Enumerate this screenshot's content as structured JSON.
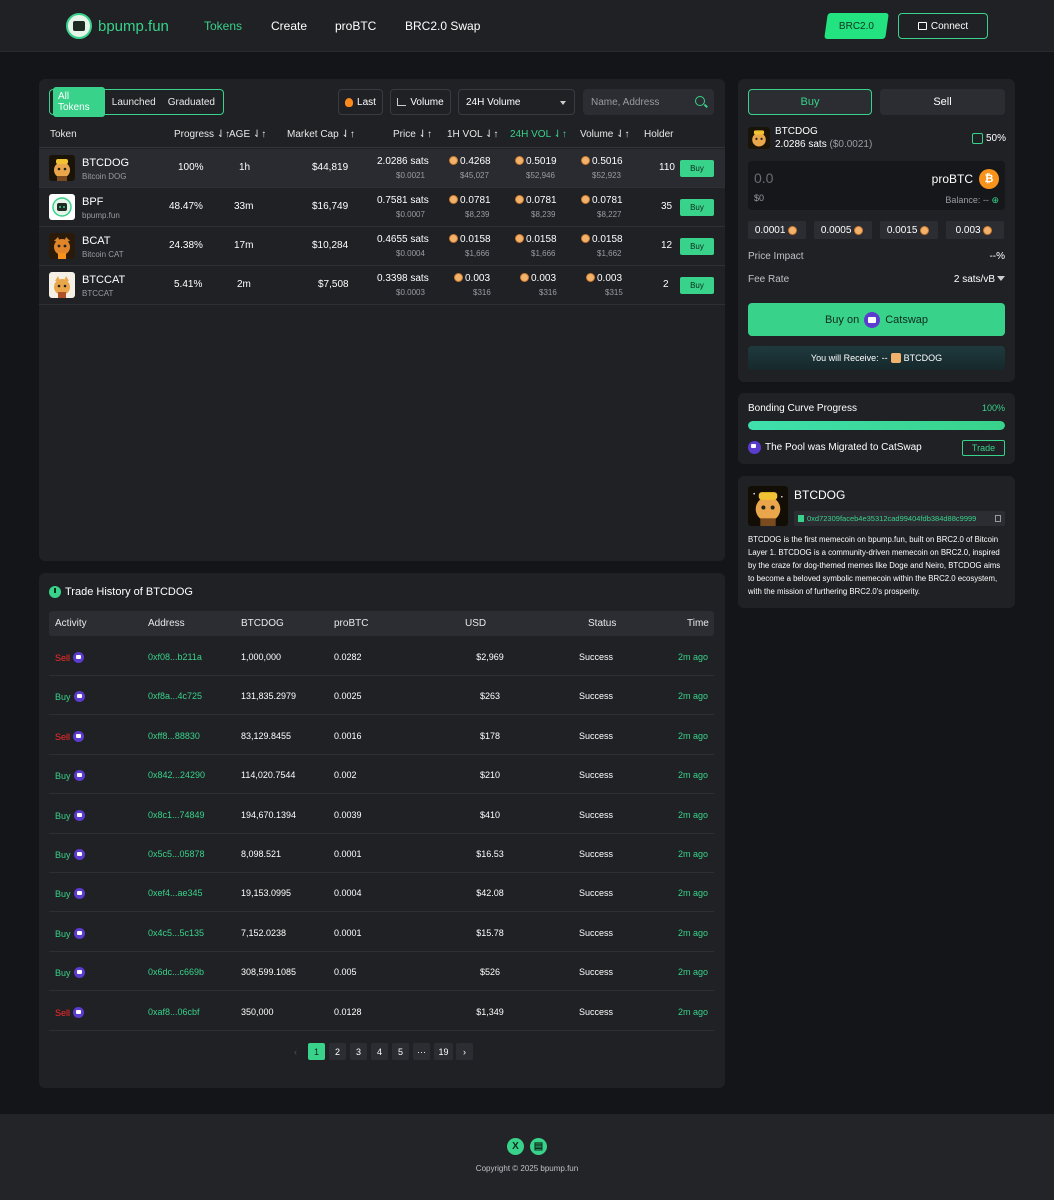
{
  "header": {
    "brand": "bpump.fun",
    "nav": [
      "Tokens",
      "Create",
      "proBTC",
      "BRC2.0 Swap"
    ],
    "network_badge": "BRC2.0",
    "connect_label": "Connect"
  },
  "tokens": {
    "filters": [
      "All Tokens",
      "Launched",
      "Graduated"
    ],
    "sort_last": "Last",
    "sort_volume": "Volume",
    "volume_select": "24H Volume",
    "search_placeholder": "Name, Address",
    "columns": [
      "Token",
      "Progress ⇃↑",
      "AGE ⇃↑",
      "Market Cap ⇃↑",
      "Price ⇃↑",
      "1H VOL ⇃↑",
      "24H VOL ⇃↑",
      "Volume ⇃↑",
      "Holder"
    ],
    "rows": [
      {
        "name": "BTCDOG",
        "sub": "Bitcoin DOG",
        "progress": "100%",
        "age": "1h",
        "mcap": "$44,819",
        "price": "2.0286 sats",
        "price_usd": "$0.0021",
        "vol1h": "0.4268",
        "vol1h_usd": "$45,027",
        "vol24h": "0.5019",
        "vol24h_usd": "$52,946",
        "vol": "0.5016",
        "vol_usd": "$52,923",
        "holders": "110",
        "buy": "Buy"
      },
      {
        "name": "BPF",
        "sub": "bpump.fun",
        "progress": "48.47%",
        "age": "33m",
        "mcap": "$16,749",
        "price": "0.7581 sats",
        "price_usd": "$0.0007",
        "vol1h": "0.0781",
        "vol1h_usd": "$8,239",
        "vol24h": "0.0781",
        "vol24h_usd": "$8,239",
        "vol": "0.0781",
        "vol_usd": "$8,227",
        "holders": "35",
        "buy": "Buy"
      },
      {
        "name": "BCAT",
        "sub": "Bitcoin CAT",
        "progress": "24.38%",
        "age": "17m",
        "mcap": "$10,284",
        "price": "0.4655 sats",
        "price_usd": "$0.0004",
        "vol1h": "0.0158",
        "vol1h_usd": "$1,666",
        "vol24h": "0.0158",
        "vol24h_usd": "$1,666",
        "vol": "0.0158",
        "vol_usd": "$1,662",
        "holders": "12",
        "buy": "Buy"
      },
      {
        "name": "BTCCAT",
        "sub": "BTCCAT",
        "progress": "5.41%",
        "age": "2m",
        "mcap": "$7,508",
        "price": "0.3398 sats",
        "price_usd": "$0.0003",
        "vol1h": "0.003",
        "vol1h_usd": "$316",
        "vol24h": "0.003",
        "vol24h_usd": "$316",
        "vol": "0.003",
        "vol_usd": "$315",
        "holders": "2",
        "buy": "Buy"
      }
    ]
  },
  "history": {
    "title": "Trade History of BTCDOG",
    "columns": [
      "Activity",
      "Address",
      "BTCDOG",
      "proBTC",
      "USD",
      "Status",
      "Time"
    ],
    "rows": [
      {
        "type": "Sell",
        "address": "0xf08...b211a",
        "amount": "1,000,000",
        "probtc": "0.0282",
        "usd": "$2,969",
        "status": "Success",
        "time": "2m ago"
      },
      {
        "type": "Buy",
        "address": "0xf8a...4c725",
        "amount": "131,835.2979",
        "probtc": "0.0025",
        "usd": "$263",
        "status": "Success",
        "time": "2m ago"
      },
      {
        "type": "Sell",
        "address": "0xff8...88830",
        "amount": "83,129.8455",
        "probtc": "0.0016",
        "usd": "$178",
        "status": "Success",
        "time": "2m ago"
      },
      {
        "type": "Buy",
        "address": "0x842...24290",
        "amount": "114,020.7544",
        "probtc": "0.002",
        "usd": "$210",
        "status": "Success",
        "time": "2m ago"
      },
      {
        "type": "Buy",
        "address": "0x8c1...74849",
        "amount": "194,670.1394",
        "probtc": "0.0039",
        "usd": "$410",
        "status": "Success",
        "time": "2m ago"
      },
      {
        "type": "Buy",
        "address": "0x5c5...05878",
        "amount": "8,098.521",
        "probtc": "0.0001",
        "usd": "$16.53",
        "status": "Success",
        "time": "2m ago"
      },
      {
        "type": "Buy",
        "address": "0xef4...ae345",
        "amount": "19,153.0995",
        "probtc": "0.0004",
        "usd": "$42.08",
        "status": "Success",
        "time": "2m ago"
      },
      {
        "type": "Buy",
        "address": "0x4c5...5c135",
        "amount": "7,152.0238",
        "probtc": "0.0001",
        "usd": "$15.78",
        "status": "Success",
        "time": "2m ago"
      },
      {
        "type": "Buy",
        "address": "0x6dc...c669b",
        "amount": "308,599.1085",
        "probtc": "0.005",
        "usd": "$526",
        "status": "Success",
        "time": "2m ago"
      },
      {
        "type": "Sell",
        "address": "0xaf8...06cbf",
        "amount": "350,000",
        "probtc": "0.0128",
        "usd": "$1,349",
        "status": "Success",
        "time": "2m ago"
      }
    ],
    "pages": [
      "1",
      "2",
      "3",
      "4",
      "5",
      "···",
      "19"
    ],
    "current_page": "1"
  },
  "trade": {
    "buy_tab": "Buy",
    "sell_tab": "Sell",
    "token_name": "BTCDOG",
    "token_price": "2.0286 sats",
    "token_price_usd": "($0.0021)",
    "slippage": "50%",
    "amount_placeholder": "0.0",
    "amount_usd": "$0",
    "pay_token": "proBTC",
    "balance_label": "Balance:",
    "balance_value": "--",
    "quick_amounts": [
      "0.0001",
      "0.0005",
      "0.0015",
      "0.003"
    ],
    "price_impact_label": "Price Impact",
    "price_impact_value": "--%",
    "fee_label": "Fee Rate",
    "fee_value": "2 sats/vB",
    "buy_button_prefix": "Buy on",
    "buy_button_dex": "Catswap",
    "receive_label": "You will Receive:",
    "receive_value": "--",
    "receive_token": "BTCDOG"
  },
  "curve": {
    "label": "Bonding Curve Progress",
    "value": "100%",
    "progress": 1.0,
    "migrated_text": "The Pool was Migrated to CatSwap",
    "trade_label": "Trade"
  },
  "info": {
    "name": "BTCDOG",
    "address": "0xd72309faceb4e35312cad99404fdb384d88c9999",
    "description": "BTCDOG is the first memecoin on bpump.fun, built on BRC2.0 of Bitcoin Layer 1. BTCDOG is a community-driven memecoin on BRC2.0, inspired by the craze for dog-themed memes like Doge and Neiro, BTCDOG aims to become a beloved symbolic memecoin within the BRC2.0 ecosystem, with the mission of furthering BRC2.0's prosperity."
  },
  "footer": {
    "copyright": "Copyright © 2025 bpump.fun",
    "social": [
      "x-icon",
      "docs-icon"
    ]
  },
  "colors": {
    "accent": "#38d28a",
    "background": "#141518",
    "panel": "#202125",
    "sell": "#ff2a2a"
  }
}
